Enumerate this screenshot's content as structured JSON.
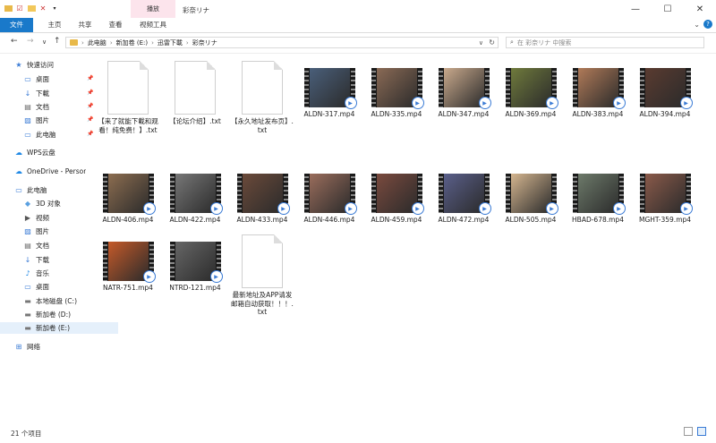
{
  "window": {
    "title": "彩奈リナ",
    "context_tab": "播放",
    "controls": [
      "minimize-icon",
      "maximize-icon",
      "close-icon"
    ]
  },
  "ribbon": {
    "tabs": [
      "文件",
      "主页",
      "共享",
      "查看",
      "视频工具"
    ]
  },
  "nav_buttons": [
    "←",
    "→",
    "∨",
    "↑"
  ],
  "address": {
    "parts": [
      "此电脑",
      "新加卷 (E:)",
      "迅雷下載",
      "彩奈リナ"
    ]
  },
  "search": {
    "placeholder": "在 彩奈リナ 中搜索"
  },
  "sidebar": {
    "items": [
      {
        "label": "快速访问",
        "icon": "star-icon",
        "pinned": false
      },
      {
        "label": "桌面",
        "icon": "desktop-icon",
        "pinned": true
      },
      {
        "label": "下載",
        "icon": "download-icon",
        "pinned": true
      },
      {
        "label": "文档",
        "icon": "document-icon",
        "pinned": true
      },
      {
        "label": "图片",
        "icon": "picture-icon",
        "pinned": true
      },
      {
        "label": "此电脑",
        "icon": "computer-icon",
        "pinned": true
      },
      {
        "label": "WPS云盘",
        "icon": "cloud-icon",
        "pinned": false
      },
      {
        "label": "OneDrive - Personal",
        "icon": "onedrive-icon",
        "pinned": false
      },
      {
        "label": "此电脑",
        "icon": "computer-icon",
        "pinned": false
      },
      {
        "label": "3D 对象",
        "icon": "cube-icon",
        "pinned": false
      },
      {
        "label": "视频",
        "icon": "video-icon",
        "pinned": false
      },
      {
        "label": "图片",
        "icon": "picture-icon",
        "pinned": false
      },
      {
        "label": "文档",
        "icon": "document-icon",
        "pinned": false
      },
      {
        "label": "下载",
        "icon": "download-icon",
        "pinned": false
      },
      {
        "label": "音乐",
        "icon": "music-icon",
        "pinned": false
      },
      {
        "label": "桌面",
        "icon": "desktop-icon",
        "pinned": false
      },
      {
        "label": "本地磁盘 (C:)",
        "icon": "drive-icon",
        "pinned": false
      },
      {
        "label": "新加卷 (D:)",
        "icon": "drive-icon",
        "pinned": false
      },
      {
        "label": "新加卷 (E:)",
        "icon": "drive-icon",
        "pinned": false,
        "selected": true
      },
      {
        "label": "网络",
        "icon": "network-icon",
        "pinned": false
      }
    ]
  },
  "files": [
    {
      "name": "【来了就能下載和观看！纯免费！】.txt",
      "type": "txt"
    },
    {
      "name": "【论坛介绍】.txt",
      "type": "txt"
    },
    {
      "name": "【永久地址发布页】.txt",
      "type": "txt"
    },
    {
      "name": "ALDN-317.mp4",
      "type": "mp4",
      "tone": "#4a5f7a"
    },
    {
      "name": "ALDN-335.mp4",
      "type": "mp4",
      "tone": "#8a6a55"
    },
    {
      "name": "ALDN-347.mp4",
      "type": "mp4",
      "tone": "#c9a98c"
    },
    {
      "name": "ALDN-369.mp4",
      "type": "mp4",
      "tone": "#6f7a3c"
    },
    {
      "name": "ALDN-383.mp4",
      "type": "mp4",
      "tone": "#b07a58"
    },
    {
      "name": "ALDN-394.mp4",
      "type": "mp4",
      "tone": "#5a3b30"
    },
    {
      "name": "ALDN-406.mp4",
      "type": "mp4",
      "tone": "#8c6d50"
    },
    {
      "name": "ALDN-422.mp4",
      "type": "mp4",
      "tone": "#777777"
    },
    {
      "name": "ALDN-433.mp4",
      "type": "mp4",
      "tone": "#6b4a3a"
    },
    {
      "name": "ALDN-446.mp4",
      "type": "mp4",
      "tone": "#9a6d5c"
    },
    {
      "name": "ALDN-459.mp4",
      "type": "mp4",
      "tone": "#7a4a3e"
    },
    {
      "name": "ALDN-472.mp4",
      "type": "mp4",
      "tone": "#5a5f8a"
    },
    {
      "name": "ALDN-505.mp4",
      "type": "mp4",
      "tone": "#d4b58f"
    },
    {
      "name": "HBAD-678.mp4",
      "type": "mp4",
      "tone": "#6d7a6a"
    },
    {
      "name": "MGHT-359.mp4",
      "type": "mp4",
      "tone": "#8a5a4a"
    },
    {
      "name": "NATR-751.mp4",
      "type": "mp4",
      "tone": "#c55a2a"
    },
    {
      "name": "NTRD-121.mp4",
      "type": "mp4",
      "tone": "#666666"
    },
    {
      "name": "最新地址及APP请发邮箱自动获取！！！.txt",
      "type": "txt"
    }
  ],
  "status": {
    "count": "21 个项目"
  },
  "colors": {
    "accent": "#1979ca",
    "context_tab": "#fce4ec",
    "selected": "#e5f0fb"
  }
}
